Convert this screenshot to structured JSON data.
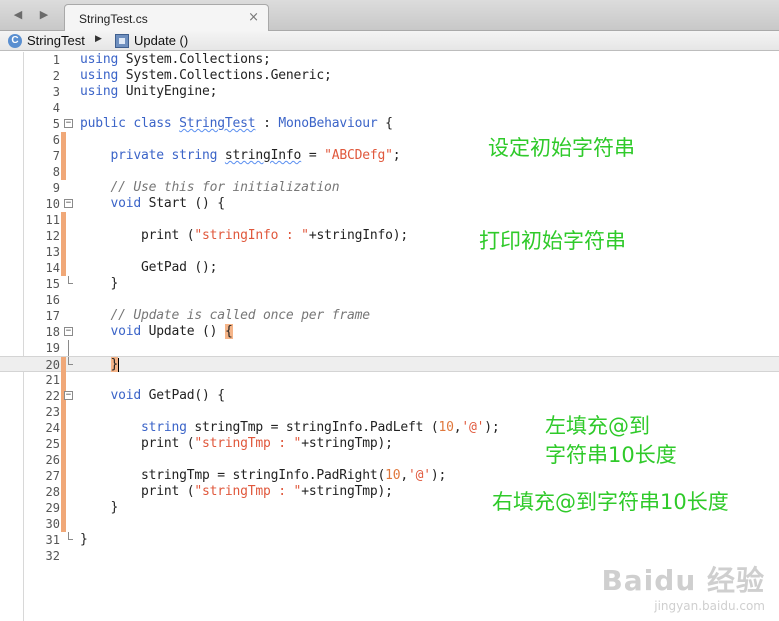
{
  "tabbar": {
    "back_icon": "chevron-left-icon",
    "forward_icon": "chevron-right-icon",
    "tab_label": "StringTest.cs",
    "close_glyph": "×"
  },
  "breadcrumb": {
    "class_name": "StringTest",
    "separator": "▶",
    "method_name": "Update ()"
  },
  "colors": {
    "keyword": "#3b64c8",
    "string": "#e0583c",
    "comment": "#777777",
    "annotation": "#2fca2a",
    "change_marker": "#f0a878"
  },
  "code_lines": [
    {
      "n": "1"
    },
    {
      "n": "2"
    },
    {
      "n": "3"
    },
    {
      "n": "4"
    },
    {
      "n": "5"
    },
    {
      "n": "6"
    },
    {
      "n": "7"
    },
    {
      "n": "8"
    },
    {
      "n": "9"
    },
    {
      "n": "10"
    },
    {
      "n": "11"
    },
    {
      "n": "12"
    },
    {
      "n": "13"
    },
    {
      "n": "14"
    },
    {
      "n": "15"
    },
    {
      "n": "16"
    },
    {
      "n": "17"
    },
    {
      "n": "18"
    },
    {
      "n": "19"
    },
    {
      "n": "20"
    },
    {
      "n": "21"
    },
    {
      "n": "22"
    },
    {
      "n": "23"
    },
    {
      "n": "24"
    },
    {
      "n": "25"
    },
    {
      "n": "26"
    },
    {
      "n": "27"
    },
    {
      "n": "28"
    },
    {
      "n": "29"
    },
    {
      "n": "30"
    },
    {
      "n": "31"
    },
    {
      "n": "32"
    }
  ],
  "code": {
    "l1_kw": "using",
    "l1_rest": " System.Collections;",
    "l2_kw": "using",
    "l2_rest": " System.Collections.Generic;",
    "l3_kw": "using",
    "l3_rest": " UnityEngine;",
    "l5_kw": "public class",
    "l5_name": "StringTest",
    "l5_colon": " : ",
    "l5_base": "MonoBehaviour",
    "l5_brace": " {",
    "l7_kw": "private",
    "l7_type": " string ",
    "l7_var": "stringInfo",
    "l7_eq": " = ",
    "l7_str": "\"ABCDefg\"",
    "l7_end": ";",
    "l9_cmt": "// Use this for initialization",
    "l10_kw": "void",
    "l10_rest": " Start () {",
    "l12_a": "print (",
    "l12_str": "\"stringInfo : \"",
    "l12_b": "+stringInfo);",
    "l14": "GetPad ();",
    "l15": "}",
    "l17_cmt": "// Update is called once per frame",
    "l18_kw": "void",
    "l18_rest": " Update () ",
    "l18_brace": "{",
    "l20": "}",
    "l22_kw": "void",
    "l22_rest": " GetPad() {",
    "l24_kw": "string",
    "l24_a": " stringTmp = stringInfo.PadLeft (",
    "l24_num": "10",
    "l24_b": ",",
    "l24_chr": "'@'",
    "l24_c": ");",
    "l25_a": "print (",
    "l25_str": "\"stringTmp : \"",
    "l25_b": "+stringTmp);",
    "l27_a": "stringTmp = stringInfo.PadRight(",
    "l27_num": "10",
    "l27_b": ",",
    "l27_chr": "'@'",
    "l27_c": ");",
    "l28_a": "print (",
    "l28_str": "\"stringTmp : \"",
    "l28_b": "+stringTmp);",
    "l29": "}",
    "l31": "}"
  },
  "annotations": {
    "a1": "设定初始字符串",
    "a2": "打印初始字符串",
    "a3_line1": "左填充@到",
    "a3_line2": "字符串10长度",
    "a4": "右填充@到字符串10长度"
  },
  "watermark": {
    "logo": "Baidu 经验",
    "url": "jingyan.baidu.com"
  }
}
